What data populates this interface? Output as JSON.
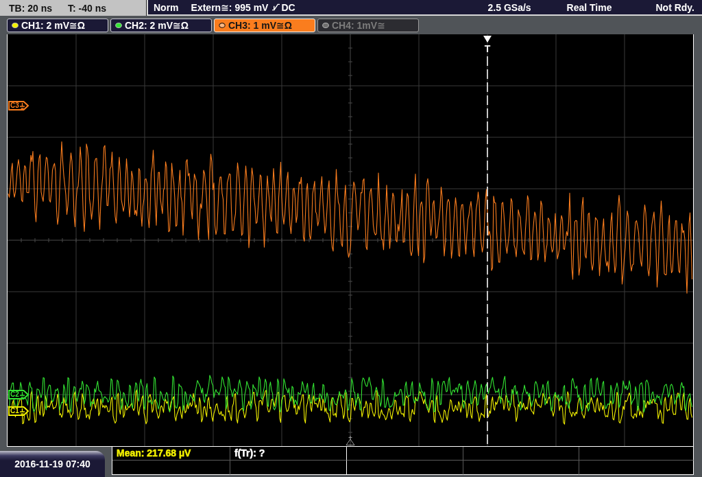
{
  "status_bar": {
    "timebase": "TB: 20 ns",
    "trigger_time": "T: -40 ns",
    "trigger_mode": "Norm",
    "trigger_source": "Extern≅: 995 mV",
    "trigger_coupling": "DC",
    "sample_rate": "2.5 GSa/s",
    "acquisition_mode": "Real Time",
    "trigger_status": "Not Rdy."
  },
  "channels": [
    {
      "label": "CH1: 2 mV≅Ω",
      "color": "#f2f000",
      "selected": false,
      "on": true
    },
    {
      "label": "CH2: 2 mV≅Ω",
      "color": "#33e533",
      "selected": false,
      "on": true
    },
    {
      "label": "CH3: 1 mV≅Ω",
      "color": "#fa7d1e",
      "selected": true,
      "on": true
    },
    {
      "label": "CH4: 1mV≅",
      "color": "#6e6e6e",
      "selected": false,
      "on": false
    }
  ],
  "trigger_marker": {
    "label": "T"
  },
  "channel_markers": [
    {
      "label": "C3",
      "color": "#fa7d1e"
    },
    {
      "label": "C2",
      "color": "#33e533"
    },
    {
      "label": "C1",
      "color": "#f2f000"
    }
  ],
  "measurements": [
    {
      "label": "Mean: 217.68 µV",
      "color": "#f2f000"
    },
    {
      "label": "f(Tr): ?",
      "color": "#ffffff"
    }
  ],
  "date_time": "2016-11-19 07:40"
}
